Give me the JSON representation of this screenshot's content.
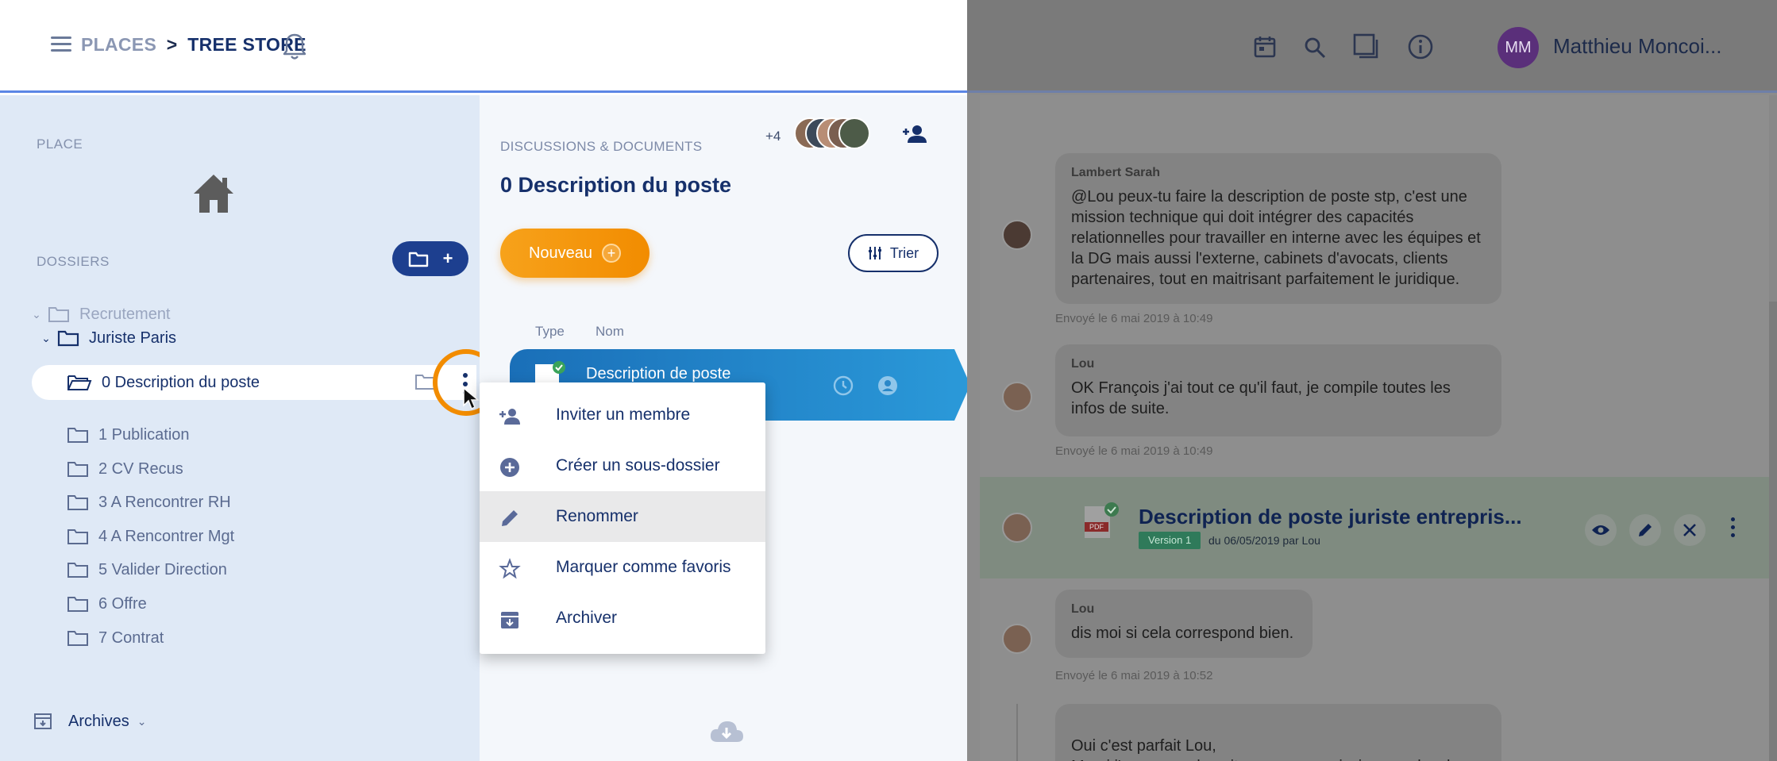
{
  "header": {
    "breadcrumb_places": "PLACES",
    "breadcrumb_sep": ">",
    "breadcrumb_current": "TREE STORE",
    "user_initials": "MM",
    "user_name": "Matthieu Moncoi..."
  },
  "sidebar": {
    "place_label": "PLACE",
    "folders_label": "DOSSIERS",
    "tree": [
      {
        "label": "Recrutement"
      },
      {
        "label": "Juriste Paris"
      },
      {
        "label": "0 Description du poste"
      },
      {
        "label": "1 Publication"
      },
      {
        "label": "2 CV Recus"
      },
      {
        "label": "3 A Rencontrer RH"
      },
      {
        "label": "4 A Rencontrer Mgt"
      },
      {
        "label": "5 Valider Direction"
      },
      {
        "label": "6 Offre"
      },
      {
        "label": "7 Contrat"
      }
    ],
    "archives_label": "Archives"
  },
  "middle": {
    "section_label": "DISCUSSIONS & DOCUMENTS",
    "title": "0 Description du poste",
    "members_extra": "+4",
    "new_button": "Nouveau",
    "sort_button": "Trier",
    "col_type": "Type",
    "col_name": "Nom",
    "doc_name": "Description de poste"
  },
  "context_menu": {
    "items": [
      {
        "label": "Inviter un membre",
        "icon": "add-person-icon"
      },
      {
        "label": "Créer un sous-dossier",
        "icon": "plus-circle-icon"
      },
      {
        "label": "Renommer",
        "icon": "pencil-icon"
      },
      {
        "label": "Marquer comme favoris",
        "icon": "star-icon"
      },
      {
        "label": "Archiver",
        "icon": "archive-icon"
      }
    ]
  },
  "chat": {
    "messages": [
      {
        "author": "Lambert Sarah",
        "text": "@Lou peux-tu faire la description de poste stp, c'est une mission technique qui doit intégrer des capacités relationnelles pour travailler en interne avec les équipes et la DG mais aussi l'externe, cabinets d'avocats, clients partenaires, tout en maitrisant parfaitement le juridique.",
        "sent": "Envoyé le 6 mai 2019 à 10:49"
      },
      {
        "author": "Lou",
        "text": "OK François j'ai tout ce qu'il faut, je compile toutes les infos de suite.",
        "sent": "Envoyé le 6 mai 2019 à 10:49"
      },
      {
        "author": "Lou",
        "text": "dis moi si cela correspond bien.",
        "sent": "Envoyé le 6 mai 2019 à 10:52"
      },
      {
        "author": "",
        "text": "Oui c'est parfait Lou,\nMerci j'approuve de suite que nous puissions enclencher",
        "sent": ""
      }
    ],
    "file": {
      "title": "Description de poste juriste entrepris...",
      "version": "Version 1",
      "meta": "du 06/05/2019 par Lou",
      "type": "PDF"
    }
  },
  "colors": {
    "accent_orange": "#f28c00",
    "navy": "#16306b",
    "sidebar_bg": "#dfe9f6",
    "doc_row_blue": "#2a98d8"
  }
}
